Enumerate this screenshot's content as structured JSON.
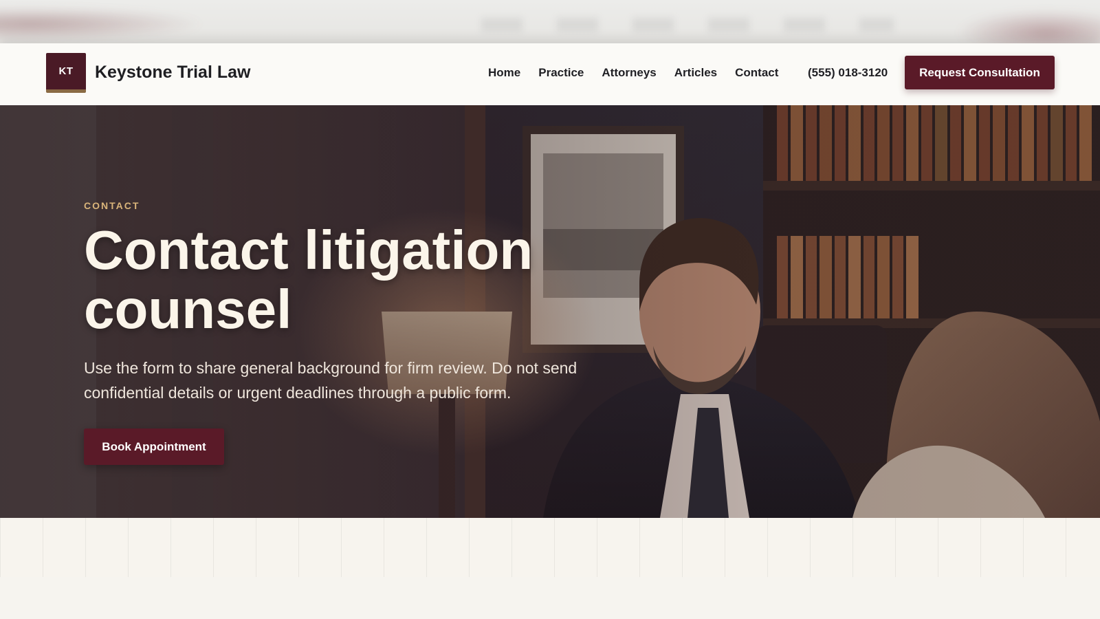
{
  "header": {
    "logo_initials": "KT",
    "brand_name": "Keystone Trial Law",
    "nav": [
      {
        "label": "Home"
      },
      {
        "label": "Practice"
      },
      {
        "label": "Attorneys"
      },
      {
        "label": "Articles"
      },
      {
        "label": "Contact"
      }
    ],
    "phone": "(555) 018-3120",
    "cta_label": "Request Consultation"
  },
  "hero": {
    "eyebrow": "CONTACT",
    "headline": "Contact litigation counsel",
    "lede": "Use the form to share general background for firm review. Do not send confidential details or urgent deadlines through a public form.",
    "cta_label": "Book Appointment"
  },
  "colors": {
    "brand": "#5a1a28",
    "logo_bg": "#4a1a26",
    "accent_gold": "#d9b47a",
    "header_bg": "#fbfaf7",
    "page_bg": "#f6f4ef"
  }
}
